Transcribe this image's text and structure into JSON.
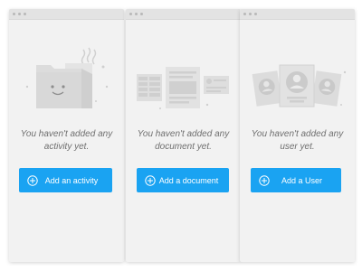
{
  "colors": {
    "button_bg": "#1aa3f2",
    "panel_bg": "#f2f2f2",
    "message_text": "#6f6f6f",
    "illustration": "#d6d6d6"
  },
  "panels": [
    {
      "icon": "folder-with-smiley-face-icon",
      "message": "You haven't added any activity yet.",
      "button_label": "Add an activity"
    },
    {
      "icon": "documents-icon",
      "message": "You haven't added any document yet.",
      "button_label": "Add a document"
    },
    {
      "icon": "user-cards-icon",
      "message": "You haven't added any user yet.",
      "button_label": "Add a User"
    }
  ]
}
